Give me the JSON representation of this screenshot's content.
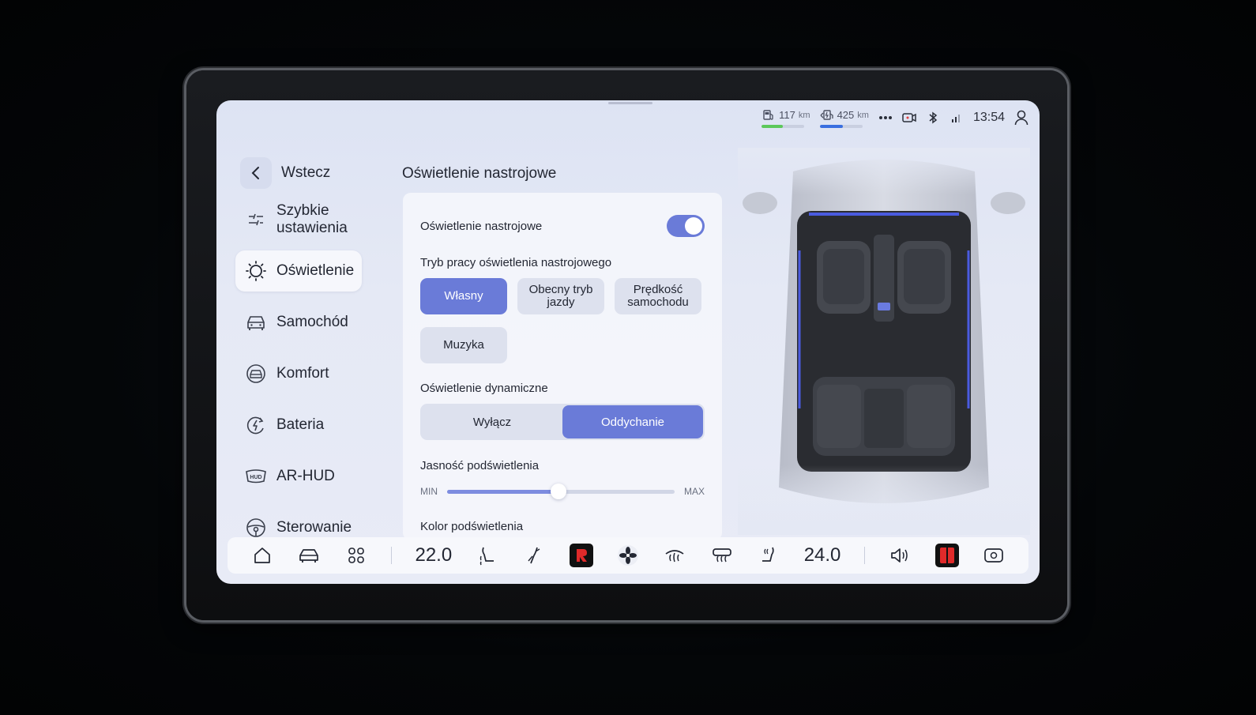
{
  "status": {
    "range1": {
      "value": "117",
      "unit": "km",
      "fill_fraction": 0.5
    },
    "range2": {
      "value": "425",
      "unit": "km",
      "fill_fraction": 0.55
    },
    "time": "13:54"
  },
  "sidebar": {
    "back_label": "Wstecz",
    "items": [
      {
        "label": "Szybkie ustawienia",
        "icon": "sliders-icon",
        "active": false
      },
      {
        "label": "Oświetlenie",
        "icon": "sun-icon",
        "active": true
      },
      {
        "label": "Samochód",
        "icon": "car-icon",
        "active": false
      },
      {
        "label": "Komfort",
        "icon": "steering-comfort-icon",
        "active": false
      },
      {
        "label": "Bateria",
        "icon": "battery-charge-icon",
        "active": false
      },
      {
        "label": "AR-HUD",
        "icon": "hud-icon",
        "active": false
      },
      {
        "label": "Sterowanie",
        "icon": "steering-wheel-icon",
        "active": false
      }
    ]
  },
  "panel": {
    "title": "Oświetlenie nastrojowe",
    "toggle_label": "Oświetlenie nastrojowe",
    "toggle_on": true,
    "mode_label": "Tryb pracy oświetlenia nastrojowego",
    "modes": [
      {
        "label": "Własny",
        "selected": true
      },
      {
        "label": "Obecny tryb jazdy",
        "selected": false
      },
      {
        "label": "Prędkość samochodu",
        "selected": false
      },
      {
        "label": "Muzyka",
        "selected": false
      }
    ],
    "dynamic_label": "Oświetlenie dynamiczne",
    "dynamic_options": [
      {
        "label": "Wyłącz",
        "selected": false
      },
      {
        "label": "Oddychanie",
        "selected": true
      }
    ],
    "brightness_label": "Jasność podświetlenia",
    "brightness_min": "MIN",
    "brightness_max": "MAX",
    "brightness_value": 0.49,
    "color_label": "Kolor podświetlenia"
  },
  "dock": {
    "temp_left": "22.0",
    "temp_right": "24.0"
  },
  "colors": {
    "accent": "#6a7bd8",
    "range1_bar": "#5cc85a",
    "range2_bar": "#3a6fe0"
  }
}
